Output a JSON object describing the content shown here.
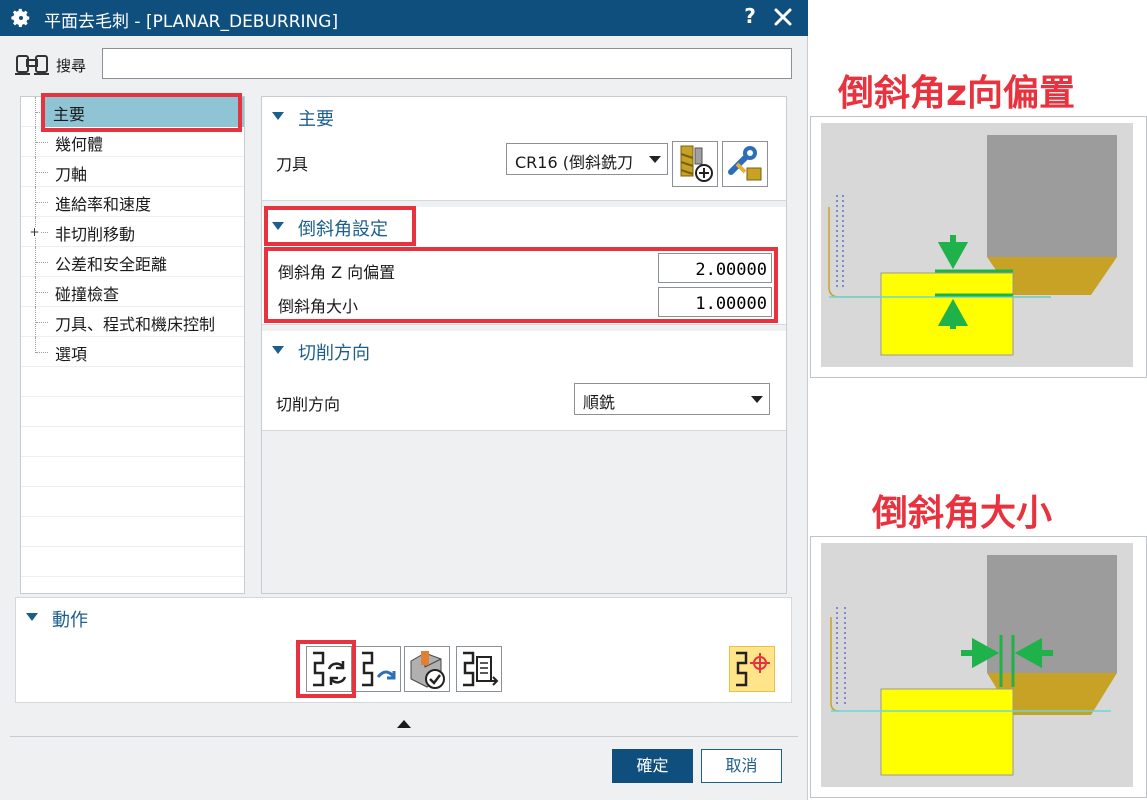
{
  "dialog": {
    "title": "平面去毛刺 - [PLANAR_DEBURRING]",
    "help": "?",
    "search_label": "搜尋",
    "search_value": ""
  },
  "tree": {
    "items": [
      {
        "label": "主要",
        "selected": true,
        "expandable": false
      },
      {
        "label": "幾何體",
        "selected": false,
        "expandable": false
      },
      {
        "label": "刀軸",
        "selected": false,
        "expandable": false
      },
      {
        "label": "進給率和速度",
        "selected": false,
        "expandable": false
      },
      {
        "label": "非切削移動",
        "selected": false,
        "expandable": true
      },
      {
        "label": "公差和安全距離",
        "selected": false,
        "expandable": false
      },
      {
        "label": "碰撞檢查",
        "selected": false,
        "expandable": false
      },
      {
        "label": "刀具、程式和機床控制",
        "selected": false,
        "expandable": false
      },
      {
        "label": "選項",
        "selected": false,
        "expandable": false
      }
    ],
    "expander_glyph": "+"
  },
  "main_group": {
    "header": "主要",
    "tool_label": "刀具",
    "tool_value": "CR16 (倒斜銑刀"
  },
  "chamfer_group": {
    "header": "倒斜角設定",
    "z_offset_label": "倒斜角 Z 向偏置",
    "z_offset_value": "2.00000",
    "size_label": "倒斜角大小",
    "size_value": "1.00000"
  },
  "cut_group": {
    "header": "切削方向",
    "direction_label": "切削方向",
    "direction_value": "順銑"
  },
  "actions": {
    "header": "動作"
  },
  "footer": {
    "ok": "確定",
    "cancel": "取消"
  },
  "annotations": {
    "z_offset_title": "倒斜角z向偏置",
    "size_title": "倒斜角大小"
  },
  "colors": {
    "titlebar": "#0e4f7e",
    "accent": "#1d5f8c",
    "highlight_red": "#e8333e",
    "selected_row": "#8fc4d5",
    "part_yellow": "#ffff00",
    "tool_gray": "#9a9a9a",
    "tool_gold": "#c8a224",
    "arrow_green": "#1fb24a"
  }
}
